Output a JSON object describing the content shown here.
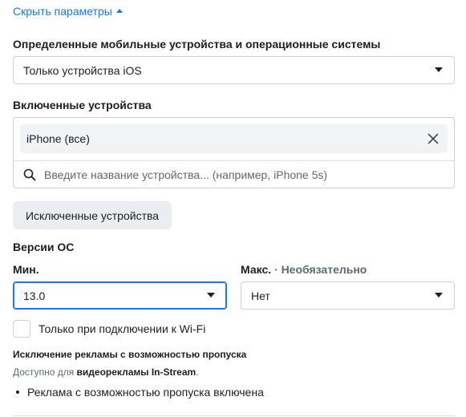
{
  "hide_params": {
    "label": "Скрыть параметры",
    "icon": "caret-up-icon"
  },
  "mobile_os": {
    "title": "Определенные мобильные устройства и операционные системы",
    "selected": "Только устройства iOS"
  },
  "included_devices": {
    "title": "Включенные устройства",
    "chips": [
      {
        "label": "iPhone (все)"
      }
    ],
    "search_placeholder": "Введите название устройства... (например, iPhone 5s)"
  },
  "excluded_devices_button": "Исключенные устройства",
  "os_versions": {
    "title": "Версии ОС",
    "min_label": "Мин.",
    "min_value": "13.0",
    "max_label": "Макс.",
    "max_optional": " · Необязательно",
    "max_value": "Нет"
  },
  "wifi_only": {
    "label": "Только при подключении к Wi-Fi",
    "checked": false
  },
  "skippable_ads": {
    "title": "Исключение рекламы с возможностью пропуска",
    "note_prefix": "Доступно для ",
    "note_bold": "видеорекламы In-Stream",
    "note_suffix": ".",
    "bullets": [
      "Реклама с возможностью пропуска включена"
    ]
  },
  "colors": {
    "accent": "#1877f2",
    "border": "#ccd0d5",
    "text": "#1c1e21",
    "muted": "#606770",
    "button_bg": "#ebedf0",
    "chip_bg": "#f2f3f5"
  }
}
